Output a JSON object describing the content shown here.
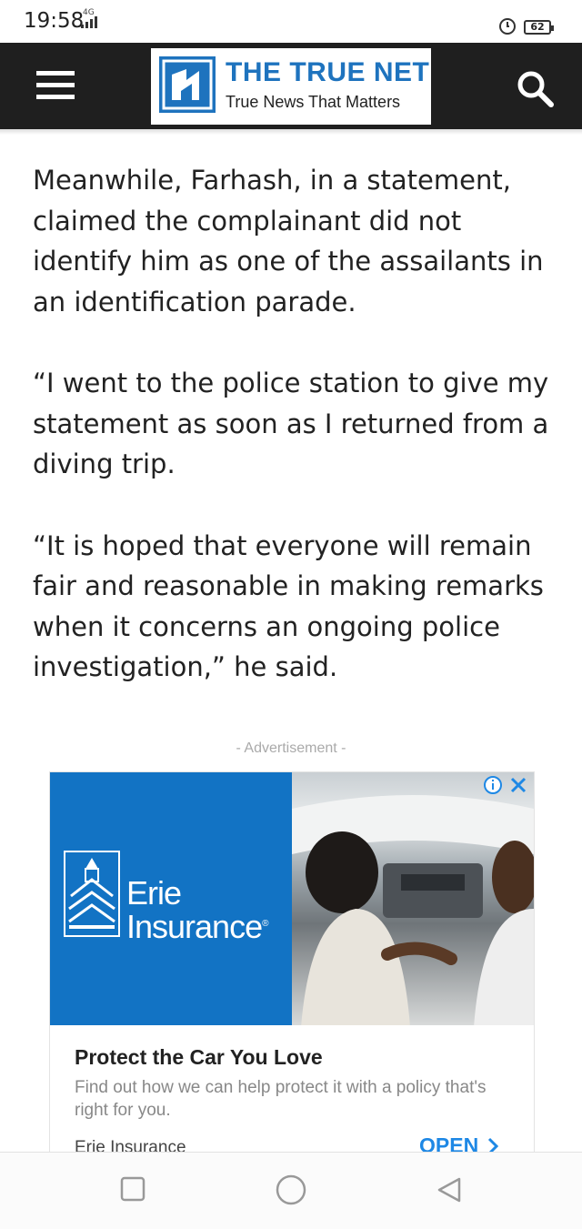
{
  "status_bar": {
    "time": "19:58",
    "network": "4G",
    "battery": "62"
  },
  "header": {
    "logo_title": "THE TRUE NET",
    "logo_tagline": "True News That Matters",
    "menu_icon": "hamburger-icon",
    "search_icon": "search-icon",
    "colors": {
      "header_bg": "#1f1f1f",
      "brand_blue": "#1e73be"
    }
  },
  "article": {
    "paragraphs": [
      "Meanwhile, Farhash, in a statement, claimed the complainant did not identify him as one of the assailants in an identification parade.",
      "“I went to the police station to give my statement as soon as I returned from a diving trip.",
      "“It is hoped that everyone will remain fair and reasonable in making remarks when it concerns an ongoing police investigation,” he said."
    ]
  },
  "ad": {
    "label": "- Advertisement -",
    "brand_line1": "Erie",
    "brand_line2": "Insurance",
    "registered": "®",
    "headline": "Protect the Car You Love",
    "body": "Find out how we can help protect it with a policy that's right for you.",
    "advertiser": "Erie Insurance",
    "cta": "OPEN",
    "colors": {
      "brand_blue": "#1273c4",
      "cta_blue": "#1e88e5"
    }
  },
  "nav_bar": {
    "icons": [
      "recents-icon",
      "home-icon",
      "back-icon"
    ]
  }
}
